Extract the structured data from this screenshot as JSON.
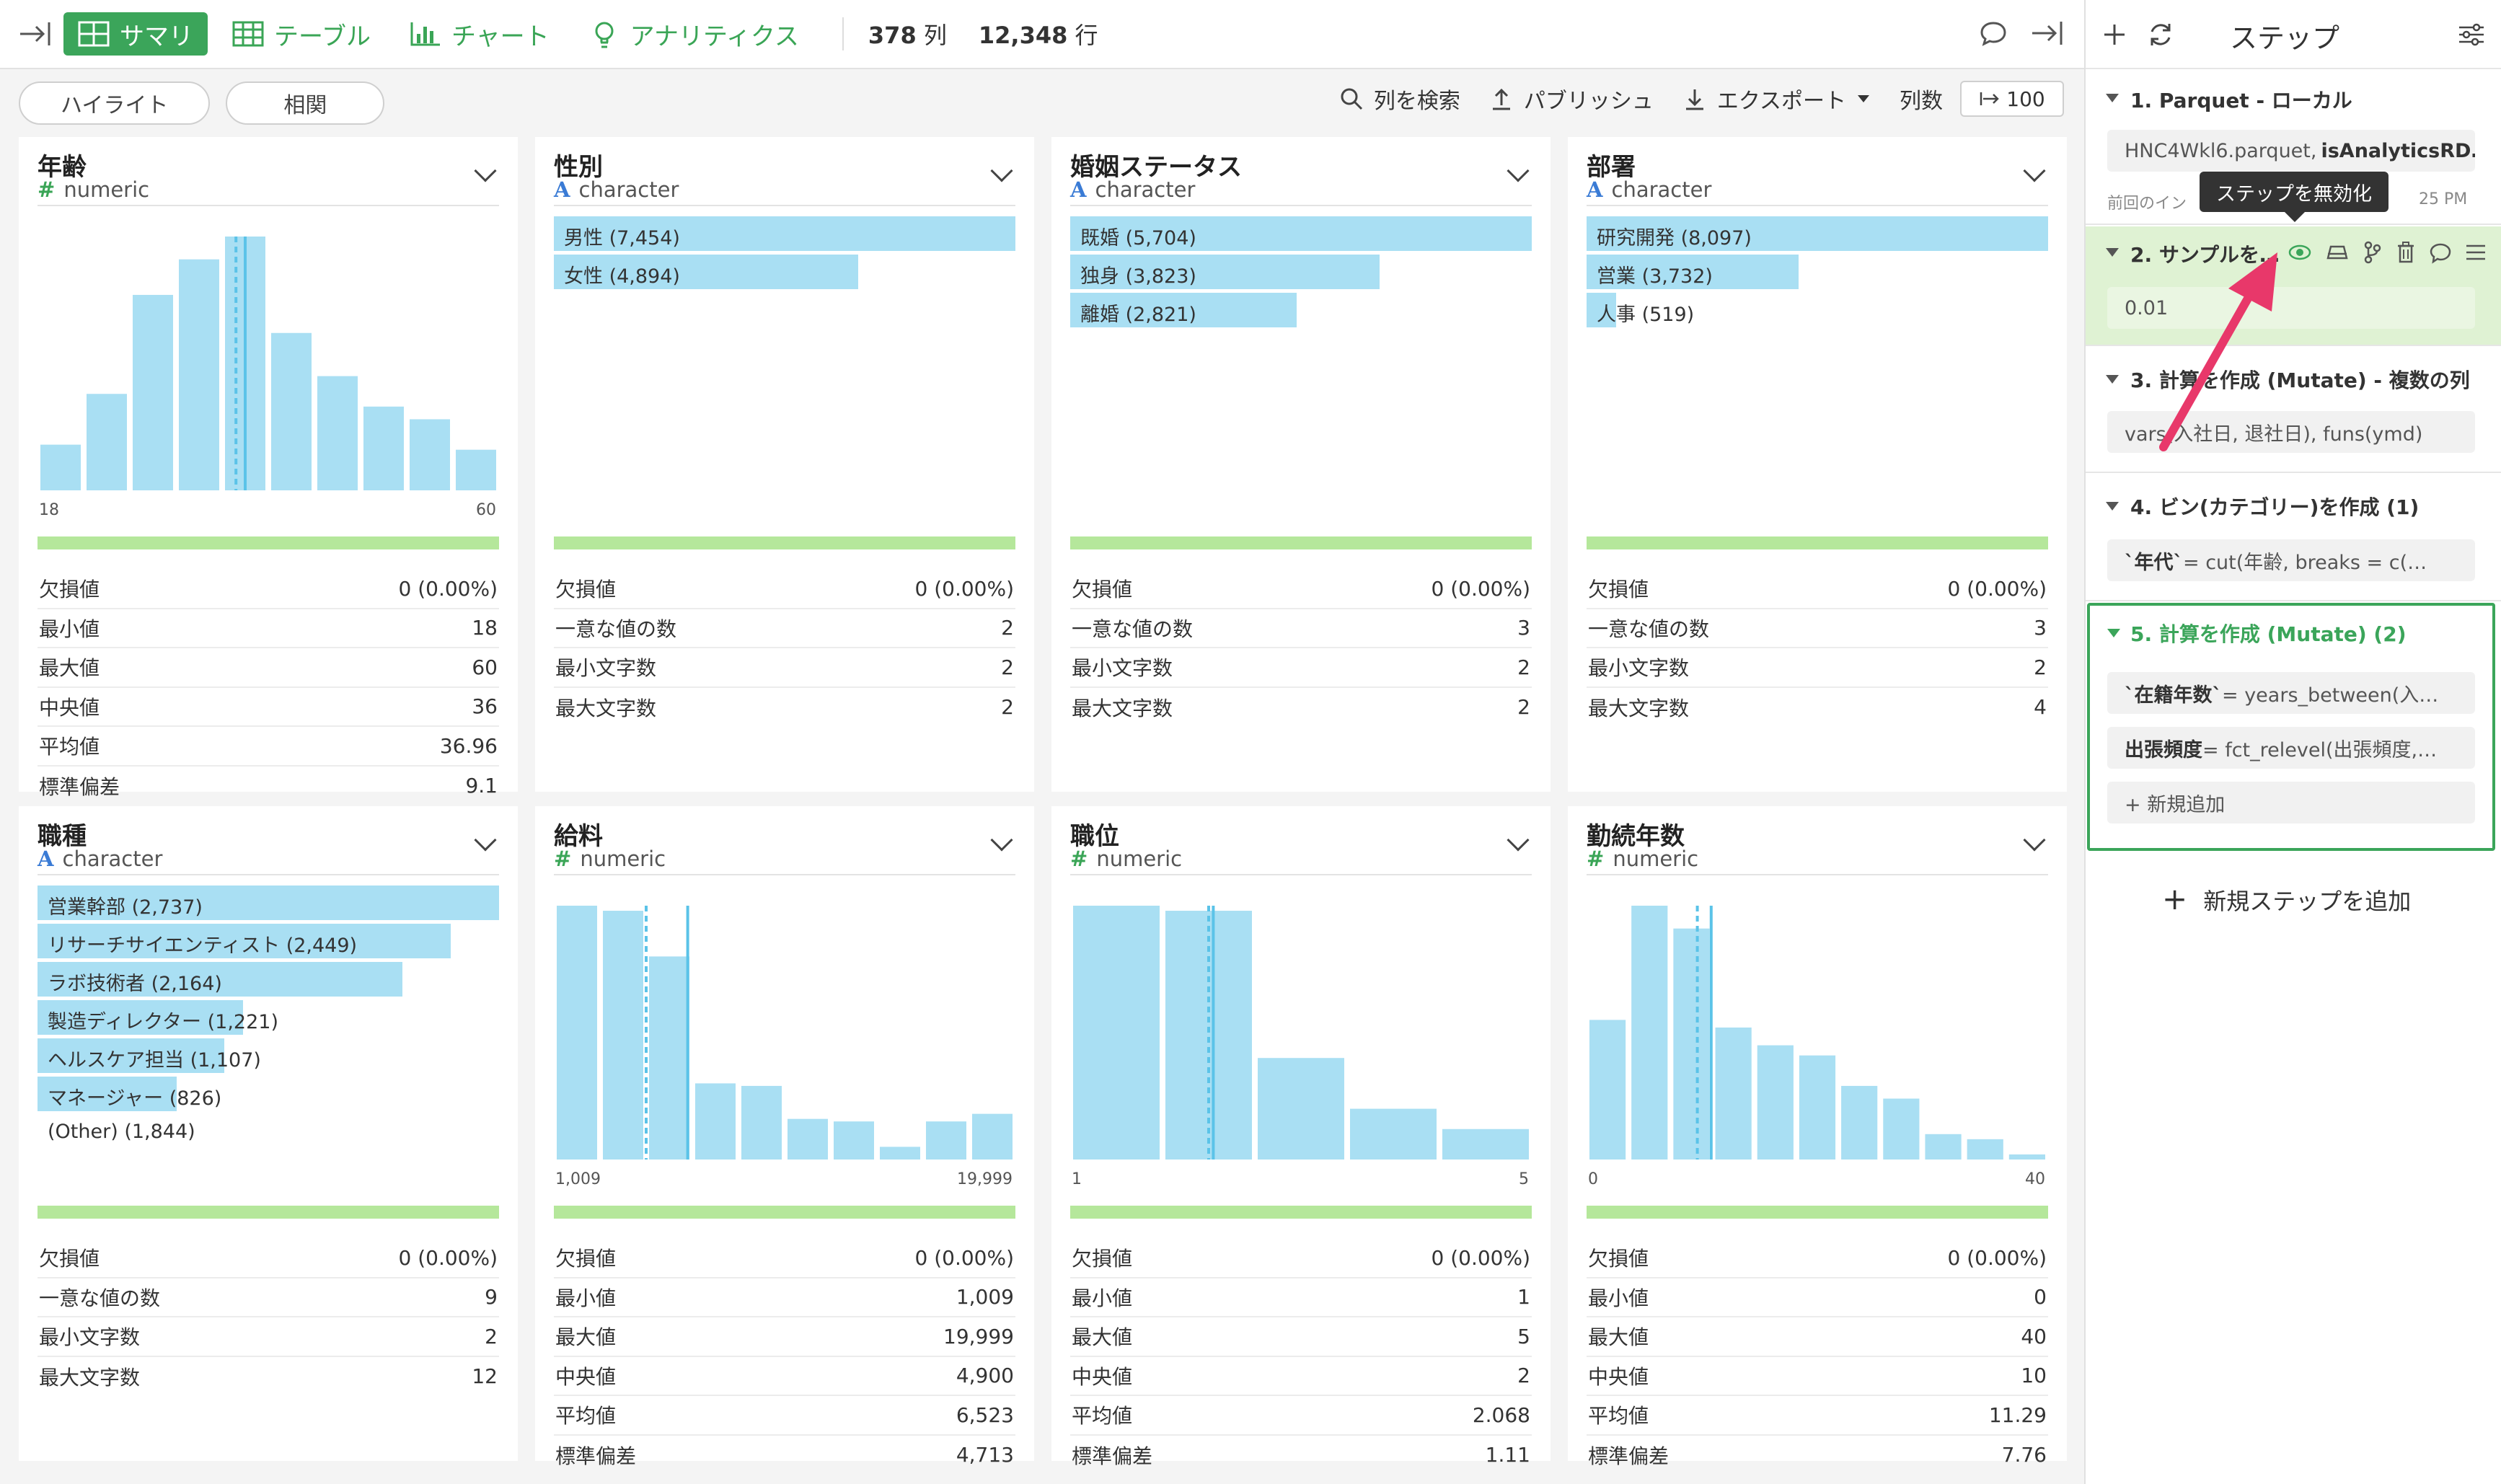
{
  "toolbar": {
    "tabs": [
      "サマリ",
      "テーブル",
      "チャート",
      "アナリティクス"
    ],
    "columns_count": "378",
    "columns_unit": "列",
    "rows_count": "12,348",
    "rows_unit": "行"
  },
  "subbar": {
    "highlight": "ハイライト",
    "correlation": "相関",
    "search": "列を検索",
    "publish": "パブリッシュ",
    "export": "エクスポート",
    "columns_label": "列数",
    "columns_value": "100"
  },
  "colors": {
    "bar": "#a9dff3",
    "accent": "#3ba55a",
    "green_bar": "#b5e79b",
    "arrow": "#e8386a"
  },
  "cards": [
    {
      "name": "年齢",
      "type": "numeric",
      "kind": "hist",
      "bars": [
        0.18,
        0.38,
        0.77,
        0.91,
        1.0,
        0.62,
        0.45,
        0.33,
        0.28,
        0.16
      ],
      "marker_pos": [
        0.43,
        0.45
      ],
      "axis_min": "18",
      "axis_max": "60",
      "stats": [
        [
          "欠損値",
          "0 (0.00%)"
        ],
        [
          "最小値",
          "18"
        ],
        [
          "最大値",
          "60"
        ],
        [
          "中央値",
          "36"
        ],
        [
          "平均値",
          "36.96"
        ],
        [
          "標準偏差",
          "9.1"
        ]
      ]
    },
    {
      "name": "性別",
      "type": "character",
      "kind": "cat",
      "items": [
        [
          "男性 (7,454)",
          1.0
        ],
        [
          "女性 (4,894)",
          0.66
        ]
      ],
      "stats": [
        [
          "欠損値",
          "0 (0.00%)"
        ],
        [
          "一意な値の数",
          "2"
        ],
        [
          "最小文字数",
          "2"
        ],
        [
          "最大文字数",
          "2"
        ]
      ]
    },
    {
      "name": "婚姻ステータス",
      "type": "character",
      "kind": "cat",
      "items": [
        [
          "既婚 (5,704)",
          1.0
        ],
        [
          "独身 (3,823)",
          0.67
        ],
        [
          "離婚 (2,821)",
          0.49
        ]
      ],
      "stats": [
        [
          "欠損値",
          "0 (0.00%)"
        ],
        [
          "一意な値の数",
          "3"
        ],
        [
          "最小文字数",
          "2"
        ],
        [
          "最大文字数",
          "2"
        ]
      ]
    },
    {
      "name": "部署",
      "type": "character",
      "kind": "cat",
      "items": [
        [
          "研究開発 (8,097)",
          1.0
        ],
        [
          "営業 (3,732)",
          0.46
        ],
        [
          "人事 (519)",
          0.064
        ]
      ],
      "stats": [
        [
          "欠損値",
          "0 (0.00%)"
        ],
        [
          "一意な値の数",
          "3"
        ],
        [
          "最小文字数",
          "2"
        ],
        [
          "最大文字数",
          "4"
        ]
      ]
    },
    {
      "name": "職種",
      "type": "character",
      "kind": "cat",
      "items": [
        [
          "営業幹部 (2,737)",
          1.0
        ],
        [
          "リサーチサイエンティスト (2,449)",
          0.895
        ],
        [
          "ラボ技術者 (2,164)",
          0.79
        ],
        [
          "製造ディレクター (1,221)",
          0.446
        ],
        [
          "ヘルスケア担当 (1,107)",
          0.404
        ],
        [
          "マネージャー (826)",
          0.302
        ],
        [
          "(Other) (1,844)",
          0
        ]
      ],
      "stats": [
        [
          "欠損値",
          "0 (0.00%)"
        ],
        [
          "一意な値の数",
          "9"
        ],
        [
          "最小文字数",
          "2"
        ],
        [
          "最大文字数",
          "12"
        ]
      ]
    },
    {
      "name": "給料",
      "type": "numeric",
      "kind": "hist",
      "bars": [
        1.0,
        0.98,
        0.8,
        0.3,
        0.29,
        0.16,
        0.15,
        0.05,
        0.15,
        0.18
      ],
      "marker_pos": [
        0.2,
        0.29
      ],
      "axis_min": "1,009",
      "axis_max": "19,999",
      "stats": [
        [
          "欠損値",
          "0 (0.00%)"
        ],
        [
          "最小値",
          "1,009"
        ],
        [
          "最大値",
          "19,999"
        ],
        [
          "中央値",
          "4,900"
        ],
        [
          "平均値",
          "6,523"
        ],
        [
          "標準偏差",
          "4,713"
        ]
      ]
    },
    {
      "name": "職位",
      "type": "numeric",
      "kind": "hist",
      "bars": [
        1.0,
        0.98,
        0.4,
        0.2,
        0.12
      ],
      "marker_pos": [
        0.3,
        0.31
      ],
      "axis_min": "1",
      "axis_max": "5",
      "stats": [
        [
          "欠損値",
          "0 (0.00%)"
        ],
        [
          "最小値",
          "1"
        ],
        [
          "最大値",
          "5"
        ],
        [
          "中央値",
          "2"
        ],
        [
          "平均値",
          "2.068"
        ],
        [
          "標準偏差",
          "1.11"
        ]
      ]
    },
    {
      "name": "勤続年数",
      "type": "numeric",
      "kind": "hist",
      "bars": [
        0.55,
        1.0,
        0.91,
        0.52,
        0.45,
        0.41,
        0.29,
        0.24,
        0.1,
        0.08,
        0.02
      ],
      "marker_pos": [
        0.24,
        0.27
      ],
      "axis_min": "0",
      "axis_max": "40",
      "stats": [
        [
          "欠損値",
          "0 (0.00%)"
        ],
        [
          "最小値",
          "0"
        ],
        [
          "最大値",
          "40"
        ],
        [
          "中央値",
          "10"
        ],
        [
          "平均値",
          "11.29"
        ],
        [
          "標準偏差",
          "7.76"
        ]
      ]
    }
  ],
  "steps_panel": {
    "title": "ステップ",
    "tooltip": "ステップを無効化",
    "steps": [
      {
        "title": "1. Parquet - ローカル",
        "expr": "HNC4Wkl6.parquet, ",
        "expr_bold": "isAnalyticsRD…",
        "note": "前回のイン",
        "note2": "25 PM"
      },
      {
        "title": "2. サンプルを…",
        "expr": "0.01"
      },
      {
        "title": "3. 計算を作成 (Mutate) - 複数の列",
        "expr": "vars(入社日, 退社日), funs(ymd)"
      },
      {
        "title": "4. ビン(カテゴリー)を作成 (1)",
        "expr_bold": "`年代`",
        "expr": " = cut(年齢, breaks = c(…"
      },
      {
        "title": "5. 計算を作成 (Mutate) (2)",
        "expr1_bold": "`在籍年数`",
        "expr1": " = years_between(入…",
        "expr2_bold": "出張頻度",
        "expr2": " = fct_relevel(出張頻度,…",
        "add": "+ 新規追加"
      }
    ],
    "add_step": "新規ステップを追加"
  }
}
